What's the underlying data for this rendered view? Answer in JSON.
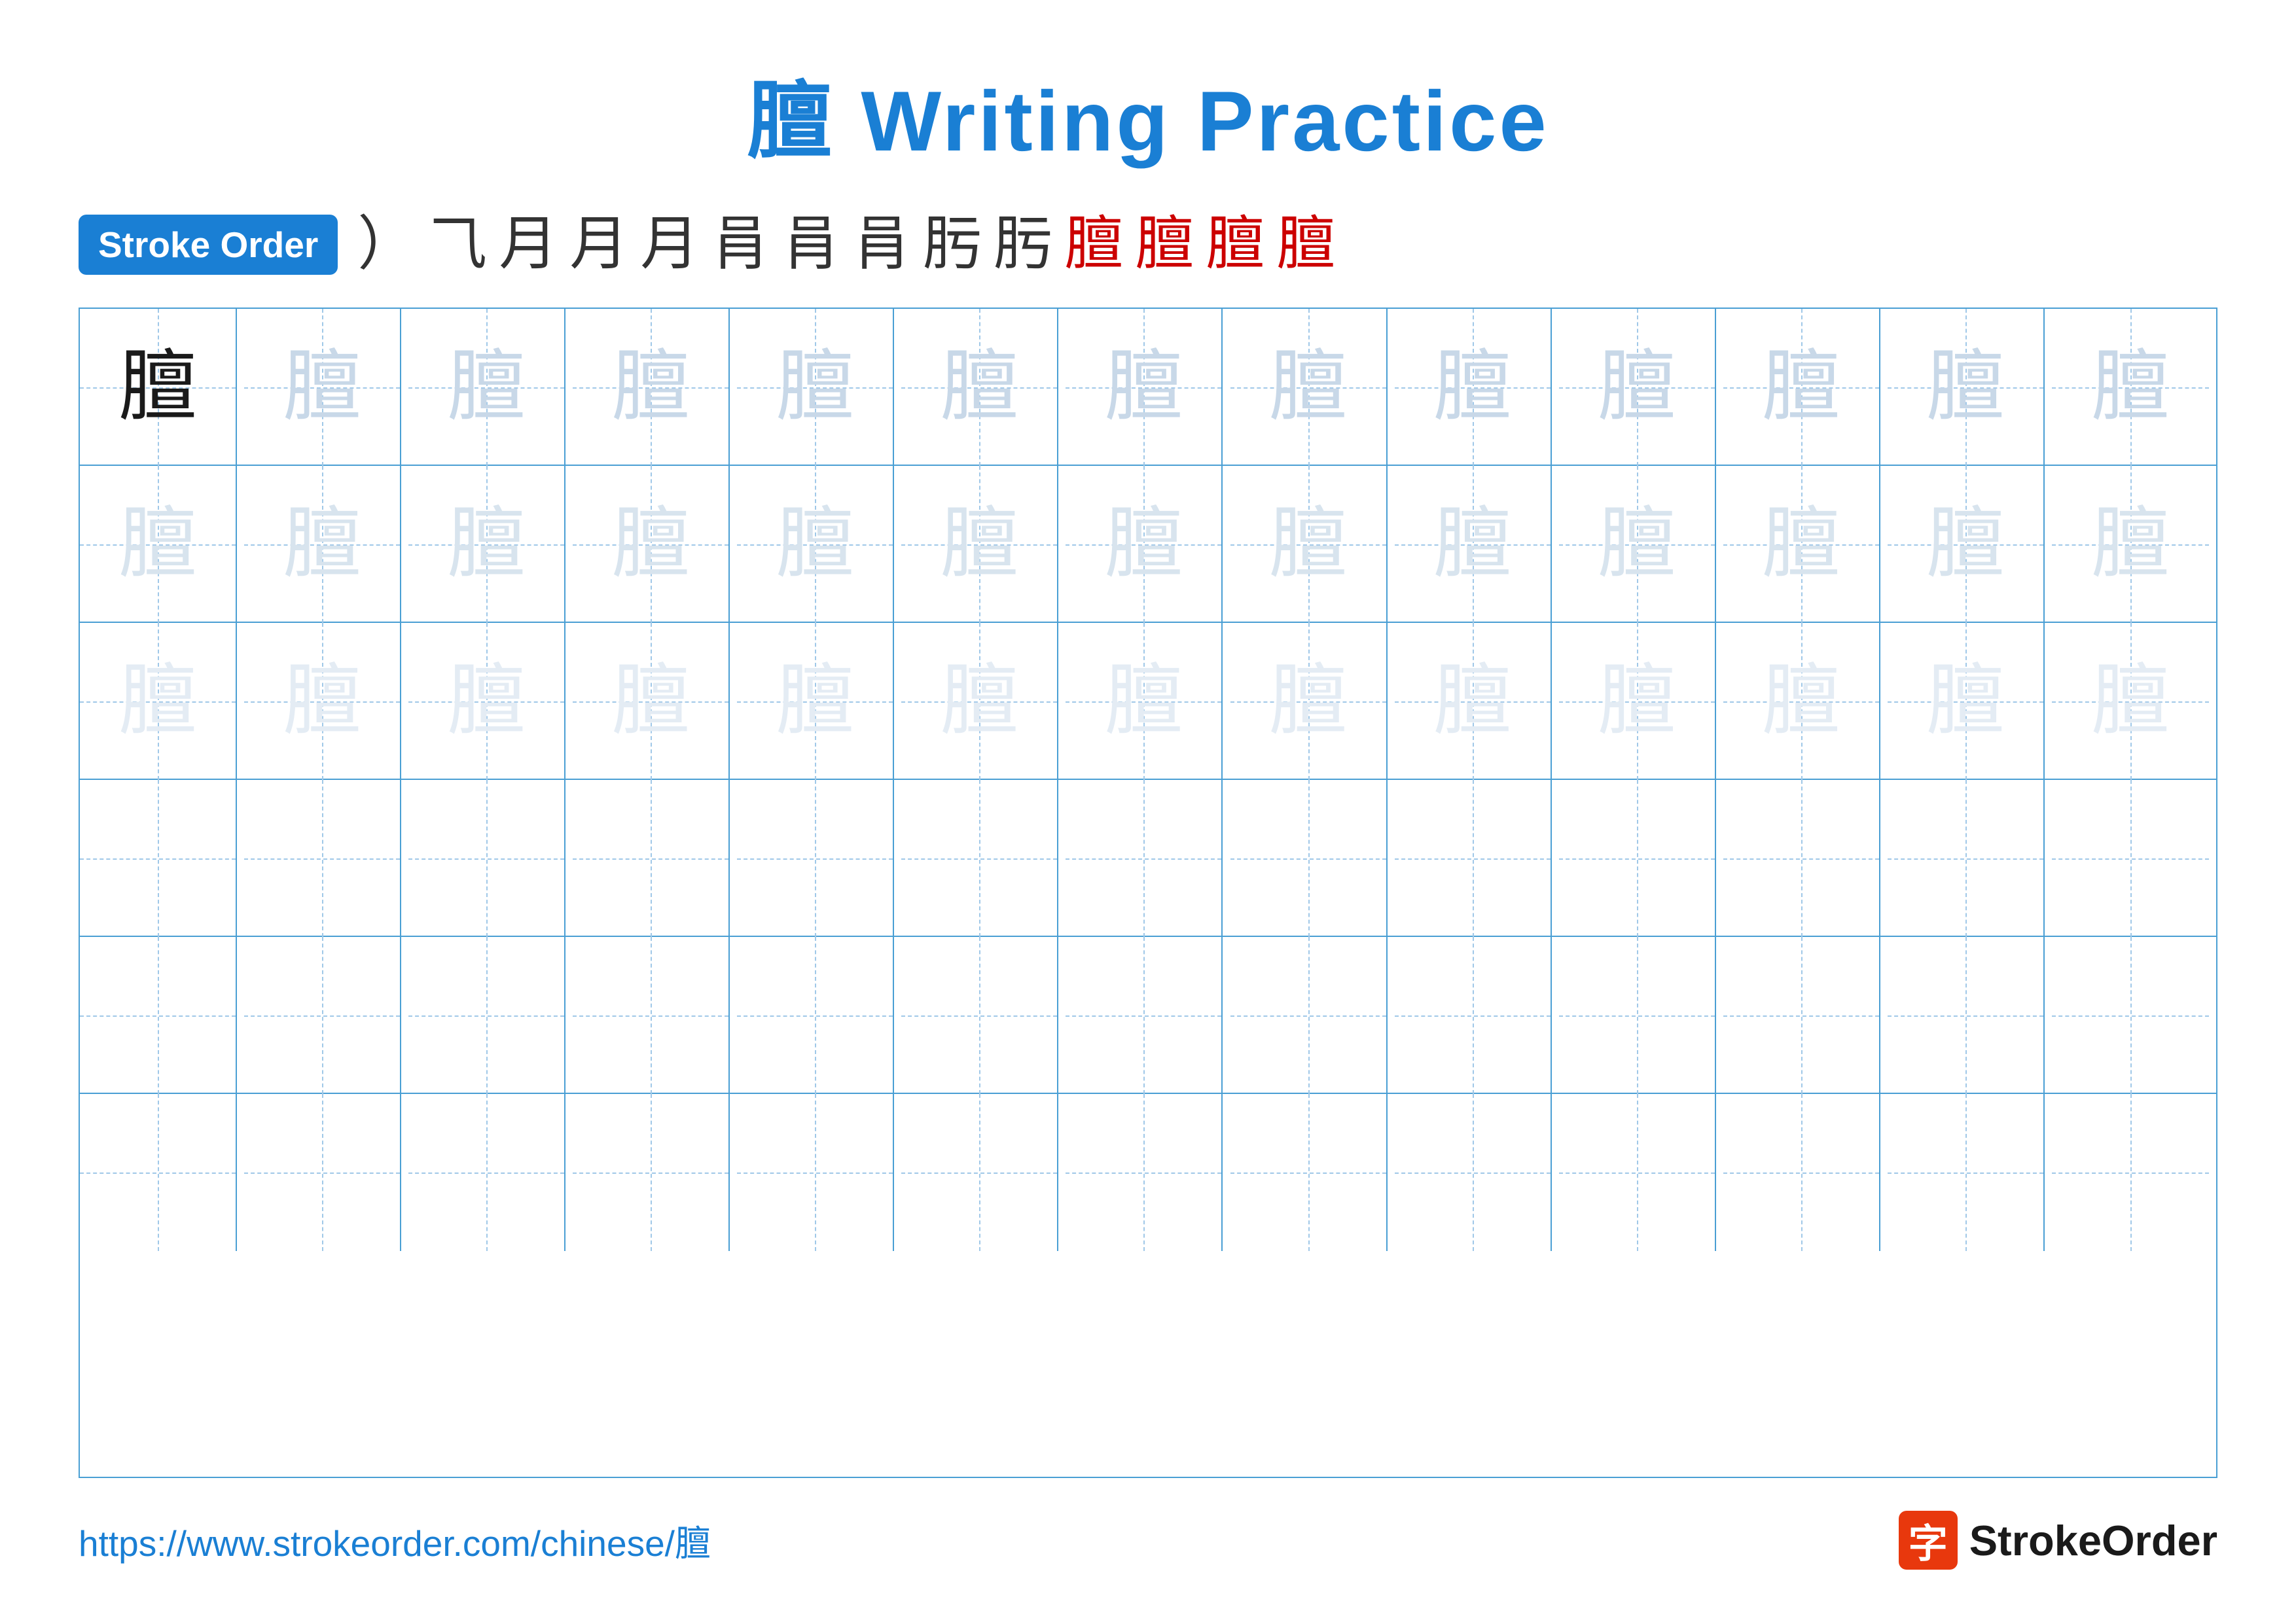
{
  "title": "膻 Writing Practice",
  "stroke_order": {
    "badge_label": "Stroke Order",
    "steps": [
      "⟩",
      "⺄",
      "月",
      "月",
      "月",
      "肙",
      "肙",
      "肙",
      "肟",
      "肟",
      "膻",
      "膻",
      "膻",
      "膻"
    ]
  },
  "character": "膻",
  "grid": {
    "rows": 6,
    "cols": 13,
    "row1_chars": [
      "膻",
      "膻",
      "膻",
      "膻",
      "膻",
      "膻",
      "膻",
      "膻",
      "膻",
      "膻",
      "膻",
      "膻",
      "膻"
    ],
    "row2_chars": [
      "膻",
      "膻",
      "膻",
      "膻",
      "膻",
      "膻",
      "膻",
      "膻",
      "膻",
      "膻",
      "膻",
      "膻",
      "膻"
    ],
    "row3_chars": [
      "膻",
      "膻",
      "膻",
      "膻",
      "膻",
      "膻",
      "膻",
      "膻",
      "膻",
      "膻",
      "膻",
      "膻",
      "膻"
    ]
  },
  "footer": {
    "url": "https://www.strokeorder.com/chinese/膻",
    "brand_icon": "字",
    "brand_name": "StrokeOrder"
  }
}
